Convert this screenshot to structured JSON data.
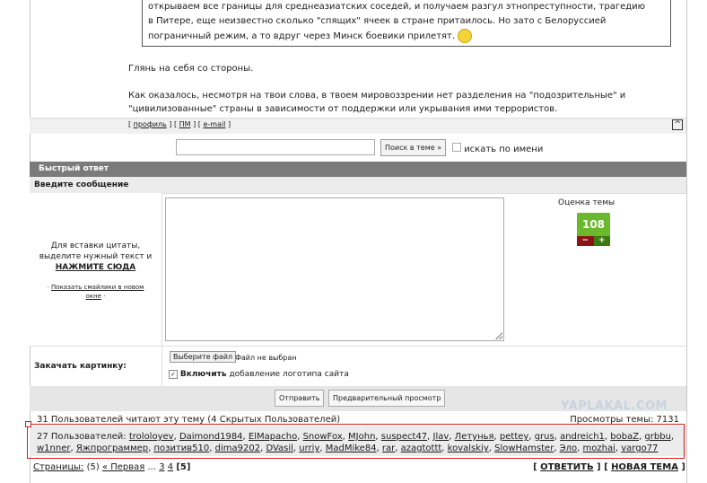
{
  "quote": {
    "line1": "открываем все границы для среднеазиатских соседей, и получаем разгул этнопреступности, трагедию",
    "line2": "в Питере, еще неизвестно сколько \"спящих\" ячеек в стране притаилось. Но зато с Белоруссией",
    "line3": "пограничный режим, а то вдруг через Минск боевики прилетят."
  },
  "post": {
    "para1": "Глянь на себя со стороны.",
    "para2_line1": "Как оказалось, несмотря на твои слова, в твоем мировоззрении нет разделения на \"подозрительные\" и",
    "para2_line2": "\"цивилизованные\" страны в зависимости от поддержки или укрывания ими террористов."
  },
  "postlinks": {
    "open": "[",
    "profile": "профиль",
    "sep1": "] [",
    "pm": "ПМ",
    "sep2": "] [",
    "email": "e-mail",
    "close": "]",
    "up": "^"
  },
  "search": {
    "input_value": "",
    "button": "Поиск в теме »",
    "by_name": "искать по имени"
  },
  "quick_reply": {
    "header": "Быстрый ответ",
    "message_label": "Введите сообщение",
    "quote_hint_line1": "Для вставки цитаты,",
    "quote_hint_line2": "выделите нужный текст и",
    "quote_hint_click": "НАЖМИТЕ СЮДА",
    "smilies_prefix": "·",
    "smilies_link_line1": "Показать смайлики в новом",
    "smilies_link_line2": "окне",
    "smilies_suffix": "·",
    "message_value": ""
  },
  "rating": {
    "label": "Оценка темы",
    "value": "108",
    "minus": "−",
    "plus": "+"
  },
  "upload": {
    "label": "Закачать картинку:",
    "choose_button": "Выберите файл",
    "file_status": "Файл не выбран",
    "logo_bold": "Включить",
    "logo_rest": " добавление логотипа сайта",
    "logo_checked": "✓"
  },
  "buttons": {
    "send": "Отправить",
    "preview": "Предварительный просмотр"
  },
  "watermark": "YAPLAKAL.COM",
  "stats": {
    "readers": "31 Пользователей читают эту тему (4 Скрытых Пользователей)",
    "views": "Просмотры темы: 7131"
  },
  "users": {
    "prefix": "27 Пользователей: ",
    "list": [
      "trololoyev",
      "Daimond1984",
      "ElMapacho",
      "SnowFox",
      "MJohn",
      "suspect47",
      "Jlav",
      "Летунья",
      "pettey",
      "grus",
      "andreich1",
      "bobaZ",
      "grbbu",
      "w1nner",
      "Яжпрограммер",
      "позитив510",
      "dima9202",
      "DVasil",
      "urriy",
      "MadMike84",
      "rar",
      "azagtottt",
      "kovalskiy",
      "SlowHamster",
      "Эло",
      "mozhai",
      "vargo77"
    ]
  },
  "pagination": {
    "label": "Страницы:",
    "count": " (5) ",
    "first": "« Первая",
    "dots": " ... ",
    "p3": "3",
    "p4": "4",
    "current": "[5]"
  },
  "reply_buttons": {
    "open1": "[ ",
    "reply": "ОТВЕТИТЬ",
    "mid": " ] [ ",
    "new_topic": "НОВАЯ ТЕМА",
    "close": " ]"
  }
}
